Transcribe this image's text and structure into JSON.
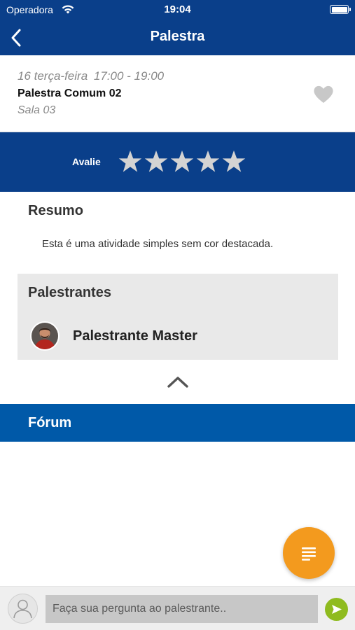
{
  "status_bar": {
    "carrier": "Operadora",
    "time": "19:04"
  },
  "nav": {
    "title": "Palestra",
    "back_icon": "chevron-left-icon"
  },
  "event": {
    "date": "16 terça-feira",
    "time_range": "17:00 - 19:00",
    "name": "Palestra Comum 02",
    "room": "Sala 03",
    "favorite_icon": "heart-icon"
  },
  "rating": {
    "label": "Avalie",
    "stars": 5,
    "selected": 0
  },
  "summary": {
    "title": "Resumo",
    "text": "Esta é uma atividade simples sem cor destacada."
  },
  "speakers": {
    "title": "Palestrantes",
    "items": [
      {
        "name": "Palestrante Master"
      }
    ]
  },
  "forum": {
    "title": "Fórum"
  },
  "question": {
    "placeholder": "Faça sua pergunta ao palestrante.."
  },
  "colors": {
    "primary": "#0a3f8a",
    "forum": "#0059a8",
    "fab": "#f39a1e",
    "send": "#8fbb1f"
  }
}
